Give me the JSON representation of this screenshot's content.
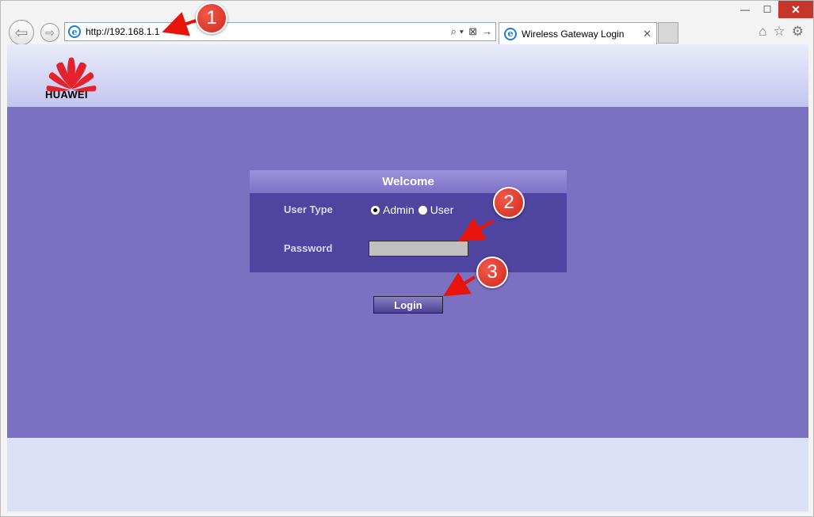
{
  "browser": {
    "url": "http://192.168.1.1",
    "tab_title": "Wireless Gateway Login",
    "tab_close": "✕",
    "window_controls": {
      "minimize": "—",
      "maximize": "☐",
      "close": "✕"
    },
    "nav": {
      "back": "⇦",
      "forward": "⇨"
    },
    "addr_tools": {
      "search": "⌕ ▾",
      "compat": "⊠",
      "go": "→"
    },
    "tools": {
      "home": "⌂",
      "favorites": "☆",
      "settings": "⚙"
    }
  },
  "page": {
    "logo_text": "HUAWEI",
    "panel_title": "Welcome",
    "user_type_label": "User Type",
    "options": {
      "admin": "Admin",
      "user": "User"
    },
    "selected_user_type": "admin",
    "password_label": "Password",
    "password_value": "",
    "login_button": "Login"
  },
  "annotations": {
    "step1": "1",
    "step2": "2",
    "step3": "3"
  },
  "colors": {
    "accent": "#7c70c2",
    "panel": "#4f44a0",
    "badge": "#d1281c"
  }
}
